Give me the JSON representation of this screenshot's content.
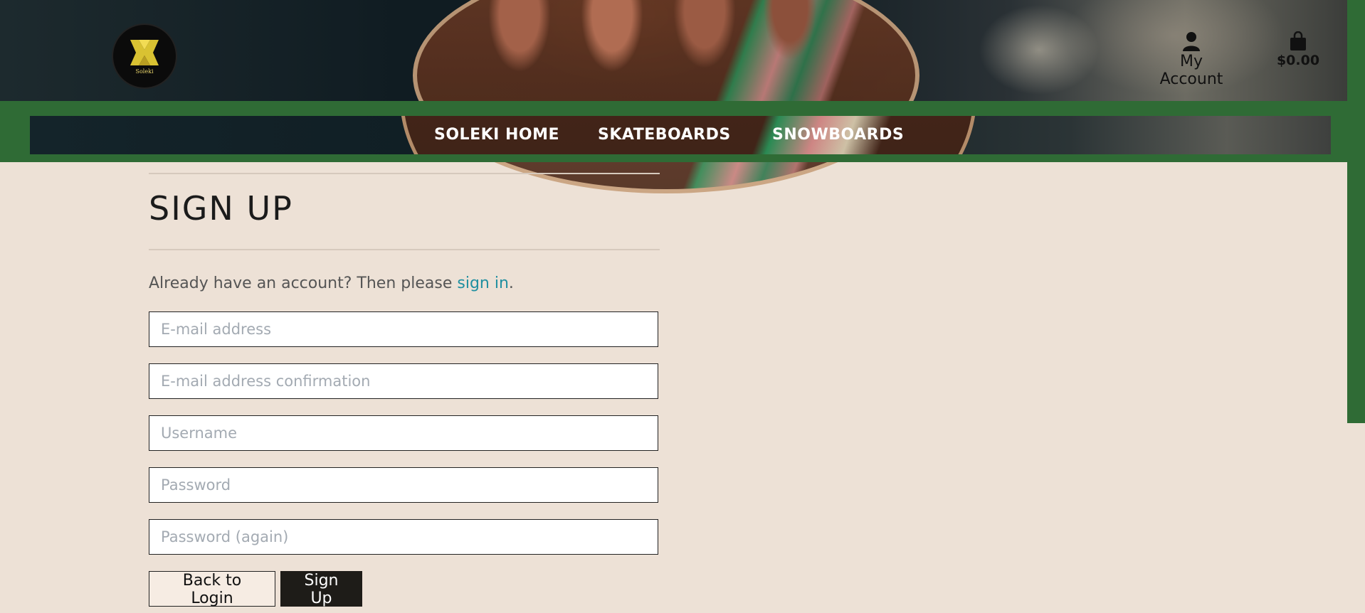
{
  "header": {
    "logo_text": "Soleki",
    "account_label": "My Account",
    "cart_total": "$0.00",
    "icons": {
      "account": "user-icon",
      "cart": "shopping-bag-icon"
    }
  },
  "nav": {
    "items": [
      {
        "label": "SOLEKI HOME"
      },
      {
        "label": "SKATEBOARDS"
      },
      {
        "label": "SNOWBOARDS"
      }
    ]
  },
  "main": {
    "title": "SIGN UP",
    "already_text": "Already have an account? Then please",
    "signin_link": "sign in",
    "already_end": ".",
    "fields": [
      {
        "placeholder": "E-mail address",
        "value": ""
      },
      {
        "placeholder": "E-mail address confirmation",
        "value": ""
      },
      {
        "placeholder": "Username",
        "value": ""
      },
      {
        "placeholder": "Password",
        "value": ""
      },
      {
        "placeholder": "Password (again)",
        "value": ""
      }
    ],
    "back_button": "Back to Login",
    "signup_button": "Sign Up"
  },
  "colors": {
    "background": "#ede1d6",
    "brand_green": "#2f6b35",
    "link": "#1f8fa0",
    "button_dark": "#1e1c18"
  }
}
